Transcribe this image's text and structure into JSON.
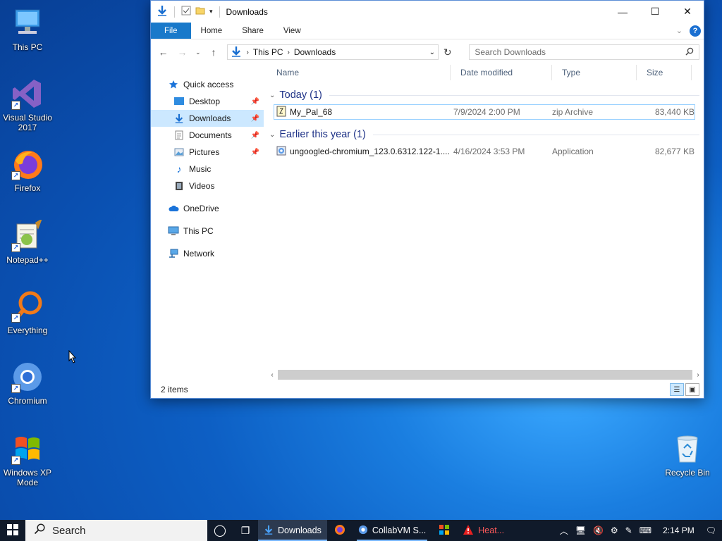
{
  "desktop": {
    "icons": [
      {
        "label": "This PC"
      },
      {
        "label": "Visual Studio 2017"
      },
      {
        "label": "Firefox"
      },
      {
        "label": "Notepad++"
      },
      {
        "label": "Everything"
      },
      {
        "label": "Chromium"
      },
      {
        "label": "Windows XP Mode"
      },
      {
        "label": "Recycle Bin"
      }
    ]
  },
  "window": {
    "title": "Downloads",
    "ribbon": {
      "file": "File",
      "home": "Home",
      "share": "Share",
      "view": "View"
    },
    "address": {
      "this_pc": "This PC",
      "current": "Downloads"
    },
    "search": {
      "placeholder": "Search Downloads"
    },
    "nav": {
      "quick_access": "Quick access",
      "desktop": "Desktop",
      "downloads": "Downloads",
      "documents": "Documents",
      "pictures": "Pictures",
      "music": "Music",
      "videos": "Videos",
      "onedrive": "OneDrive",
      "this_pc": "This PC",
      "network": "Network"
    },
    "columns": {
      "name": "Name",
      "date": "Date modified",
      "type": "Type",
      "size": "Size"
    },
    "groups": [
      {
        "label": "Today (1)",
        "files": [
          {
            "name": "My_Pal_68",
            "date": "7/9/2024 2:00 PM",
            "type": "zip Archive",
            "size": "83,440 KB"
          }
        ]
      },
      {
        "label": "Earlier this year (1)",
        "files": [
          {
            "name": "ungoogled-chromium_123.0.6312.122-1....",
            "date": "4/16/2024 3:53 PM",
            "type": "Application",
            "size": "82,677 KB"
          }
        ]
      }
    ],
    "status": {
      "items": "2 items"
    }
  },
  "taskbar": {
    "search": "Search",
    "apps": {
      "downloads": "Downloads",
      "collabvm": "CollabVM S...",
      "heat": "Heat..."
    },
    "clock": "2:14 PM"
  },
  "colors": {
    "accent": "#1979ca",
    "selection": "#cce8ff",
    "group_header": "#1e3287"
  }
}
